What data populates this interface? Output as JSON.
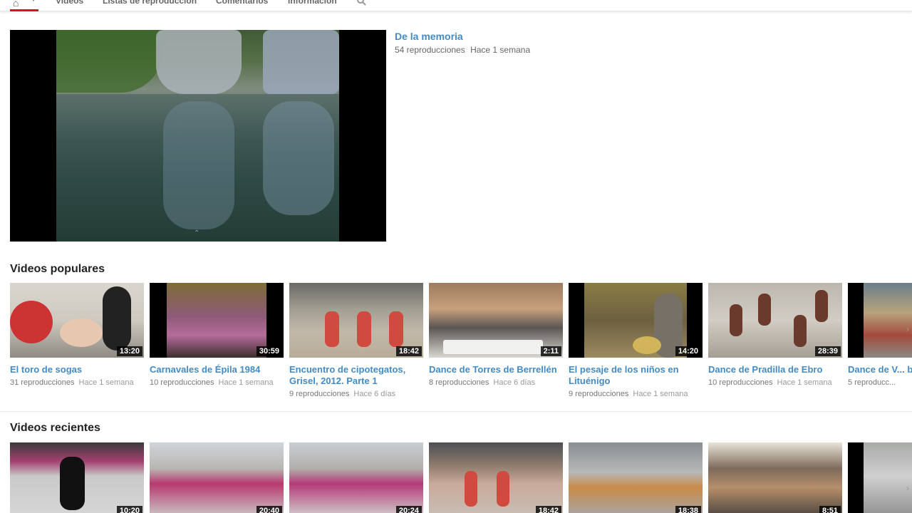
{
  "nav": {
    "tabs": [
      "Videos",
      "Listas de reproducción",
      "Comentarios",
      "Información"
    ]
  },
  "featured": {
    "title": "De la memoria",
    "views": "54 reproducciones",
    "ago": "Hace 1 semana"
  },
  "popular": {
    "heading": "Videos populares",
    "items": [
      {
        "title": "El toro de sogas",
        "duration": "13:20",
        "views": "31 reproducciones",
        "ago": "Hace 1 semana"
      },
      {
        "title": "Carnavales de Épila 1984",
        "duration": "30:59",
        "views": "10 reproducciones",
        "ago": "Hace 1 semana"
      },
      {
        "title": "Encuentro de cipotegatos, Grisel, 2012. Parte 1",
        "duration": "18:42",
        "views": "9 reproducciones",
        "ago": "Hace 6 días"
      },
      {
        "title": "Dance de Torres de Berrellén",
        "duration": "2:11",
        "views": "8 reproducciones",
        "ago": "Hace 6 días"
      },
      {
        "title": "El pesaje de los niños en Lituénigo",
        "duration": "14:20",
        "views": "9 reproducciones",
        "ago": "Hace 1 semana"
      },
      {
        "title": "Dance de Pradilla de Ebro",
        "duration": "28:39",
        "views": "10 reproducciones",
        "ago": "Hace 1 semana"
      },
      {
        "title": "Dance de V... baile de la l...",
        "duration": "",
        "views": "5 reproducc...",
        "ago": ""
      }
    ]
  },
  "recent": {
    "heading": "Videos recientes",
    "items": [
      {
        "duration": "10:20"
      },
      {
        "duration": "20:40"
      },
      {
        "duration": "20:24"
      },
      {
        "duration": "18:42"
      },
      {
        "duration": "18:38"
      },
      {
        "duration": "8:51"
      },
      {
        "duration": ""
      }
    ]
  },
  "colors": {
    "link": "#438bc5",
    "accent": "#cc181e"
  }
}
